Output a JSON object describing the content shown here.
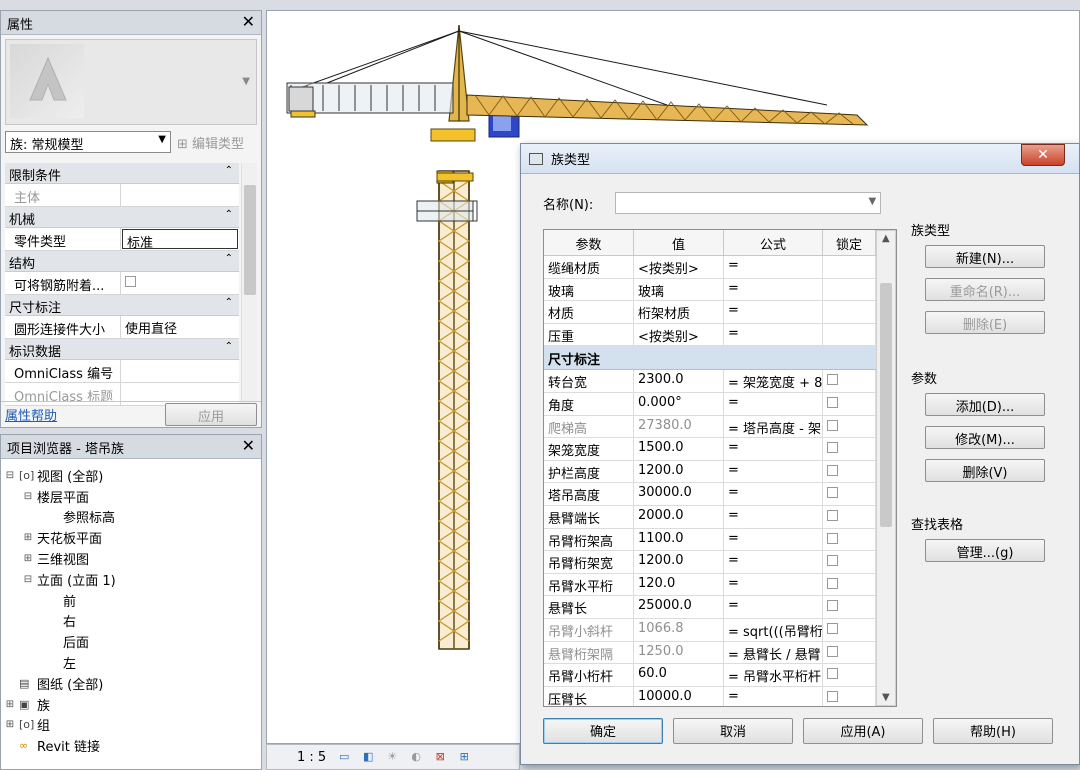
{
  "properties": {
    "title": "属性",
    "close": "✕",
    "type_selector": "族: 常规模型",
    "edit_type": "编辑类型",
    "sections": [
      {
        "label": "限制条件",
        "rows": [
          {
            "key": "主体",
            "value": ""
          }
        ]
      },
      {
        "label": "机械",
        "rows": [
          {
            "key": "零件类型",
            "value": "标准"
          }
        ]
      },
      {
        "label": "结构",
        "rows": [
          {
            "key": "可将钢筋附着...",
            "value": ""
          }
        ]
      },
      {
        "label": "尺寸标注",
        "rows": [
          {
            "key": "圆形连接件大小",
            "value": "使用直径"
          }
        ]
      },
      {
        "label": "标识数据",
        "rows": [
          {
            "key": "OmniClass 编号",
            "value": ""
          },
          {
            "key": "OmniClass 标题",
            "value": ""
          }
        ]
      }
    ],
    "help_link": "属性帮助",
    "apply": "应用"
  },
  "browser": {
    "title": "项目浏览器 - 塔吊族",
    "close": "✕",
    "nodes": {
      "views": "视图 (全部)",
      "floor_plans": "楼层平面",
      "ref_level": "参照标高",
      "ceiling": "天花板平面",
      "three_d": "三维视图",
      "elevations": "立面 (立面 1)",
      "front": "前",
      "right": "右",
      "back": "后面",
      "left": "左",
      "sheets": "图纸 (全部)",
      "families": "族",
      "groups": "组",
      "revit_links": "Revit 链接"
    }
  },
  "status_bar": {
    "scale": "1 : 5"
  },
  "dialog": {
    "title": "族类型",
    "close": "✕",
    "name_label": "名称(N):",
    "name_value": "",
    "columns": [
      "参数",
      "值",
      "公式",
      "锁定"
    ],
    "rows_top": [
      {
        "param": "缆绳材质",
        "value": "<按类别>",
        "formula": "="
      },
      {
        "param": "玻璃",
        "value": "玻璃",
        "formula": "="
      },
      {
        "param": "材质",
        "value": "桁架材质",
        "formula": "="
      },
      {
        "param": "压重",
        "value": "<按类别>",
        "formula": "="
      }
    ],
    "section_label": "尺寸标注",
    "rows_dim": [
      {
        "param": "转台宽",
        "value": "2300.0",
        "formula": "= 架笼宽度 + 8"
      },
      {
        "param": "角度",
        "value": "0.000°",
        "formula": "="
      },
      {
        "param": "爬梯高",
        "value": "27380.0",
        "formula": "= 塔吊高度 - 架"
      },
      {
        "param": "架笼宽度",
        "value": "1500.0",
        "formula": "="
      },
      {
        "param": "护栏高度",
        "value": "1200.0",
        "formula": "="
      },
      {
        "param": "塔吊高度",
        "value": "30000.0",
        "formula": "="
      },
      {
        "param": "悬臂端长",
        "value": "2000.0",
        "formula": "="
      },
      {
        "param": "吊臂桁架高",
        "value": "1100.0",
        "formula": "="
      },
      {
        "param": "吊臂桁架宽",
        "value": "1200.0",
        "formula": "="
      },
      {
        "param": "吊臂水平桁",
        "value": "120.0",
        "formula": "="
      },
      {
        "param": "悬臂长",
        "value": "25000.0",
        "formula": "="
      },
      {
        "param": "吊臂小斜杆",
        "value": "1066.8",
        "formula": "= sqrt(((吊臂桁"
      },
      {
        "param": "悬臂桁架隔",
        "value": "1250.0",
        "formula": "= 悬臂长 / 悬臂"
      },
      {
        "param": "吊臂小桁杆",
        "value": "60.0",
        "formula": "= 吊臂水平桁杆"
      },
      {
        "param": "压臂长",
        "value": "10000.0",
        "formula": "="
      }
    ],
    "group_family_types": "族类型",
    "btn_new": "新建(N)...",
    "btn_rename": "重命名(R)...",
    "btn_delete_type": "删除(E)",
    "group_params": "参数",
    "btn_add": "添加(D)...",
    "btn_modify": "修改(M)...",
    "btn_delete_param": "删除(V)",
    "group_lookup": "查找表格",
    "btn_manage": "管理...(g)",
    "btn_ok": "确定",
    "btn_cancel": "取消",
    "btn_apply": "应用(A)",
    "btn_help": "帮助(H)"
  }
}
